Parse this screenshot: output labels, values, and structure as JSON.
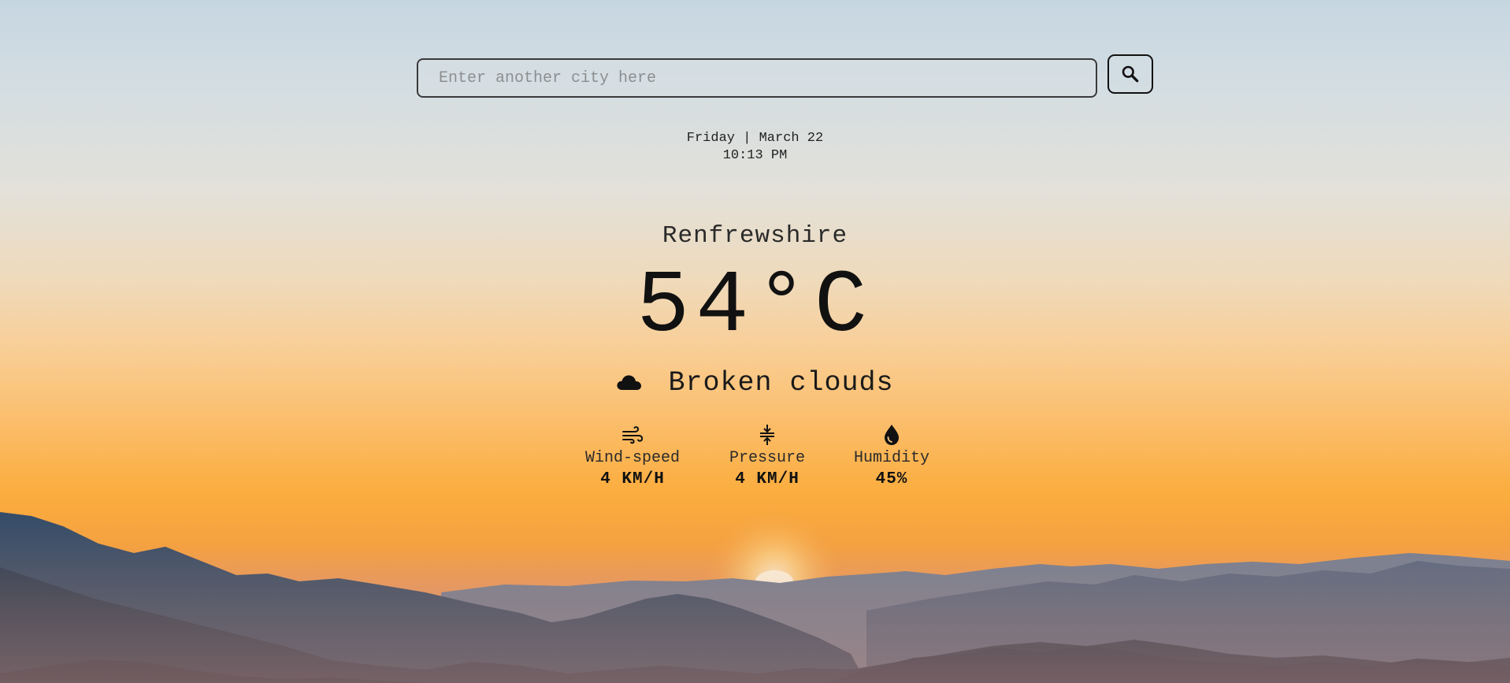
{
  "search": {
    "placeholder": "Enter another city here",
    "value": ""
  },
  "datetime": {
    "date": "Friday | March 22",
    "time": "10:13 PM"
  },
  "weather": {
    "city": "Renfrewshire",
    "temperature": "54°C",
    "condition": "Broken clouds",
    "condition_icon": "cloud-icon"
  },
  "stats": [
    {
      "icon": "wind-icon",
      "label": "Wind-speed",
      "value": "4 KM/H"
    },
    {
      "icon": "pressure-icon",
      "label": "Pressure",
      "value": "4 KM/H"
    },
    {
      "icon": "humidity-drop-icon",
      "label": "Humidity",
      "value": "45%"
    }
  ],
  "colors": {
    "sky_top": "#c6d6e1",
    "sky_bottom": "#fbad3e",
    "mountains": "#2f4a66"
  }
}
